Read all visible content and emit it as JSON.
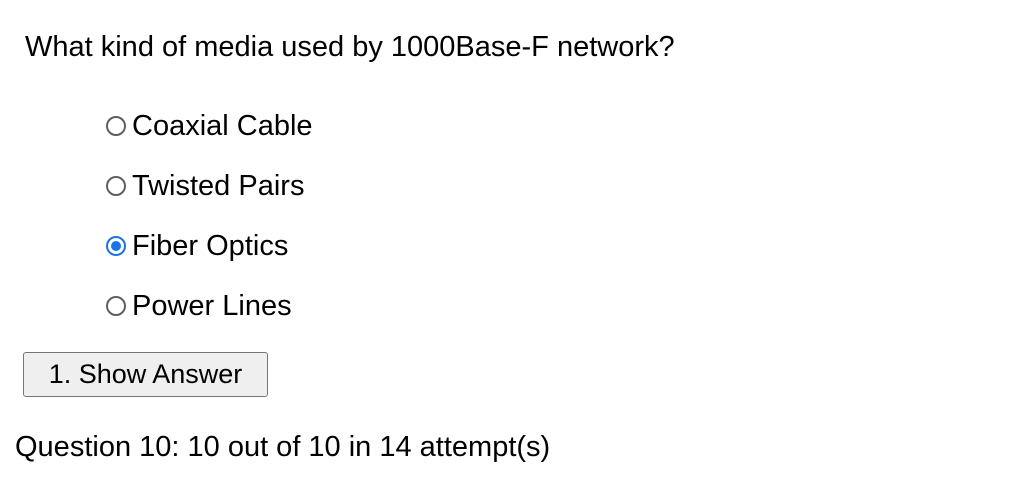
{
  "question": {
    "text": "What kind of media used by 1000Base-F network?",
    "options": [
      {
        "label": "Coaxial Cable",
        "selected": false
      },
      {
        "label": "Twisted Pairs",
        "selected": false
      },
      {
        "label": "Fiber Optics",
        "selected": true
      },
      {
        "label": "Power Lines",
        "selected": false
      }
    ]
  },
  "actions": {
    "show_answer_label": "1. Show Answer"
  },
  "status": {
    "score_text": "Question 10: 10 out of 10 in 14 attempt(s)"
  },
  "colors": {
    "radio_checked": "#1a73e8",
    "button_background": "#efefef"
  }
}
